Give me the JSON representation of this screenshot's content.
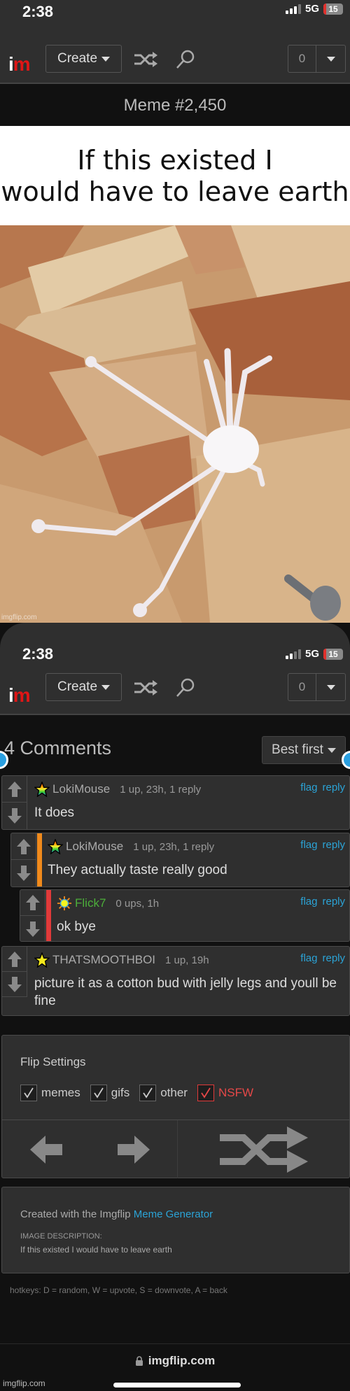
{
  "status_bar": {
    "time": "2:38",
    "network": "5G",
    "battery": "15"
  },
  "nav": {
    "logo_i": "i",
    "logo_m": "m",
    "create_label": "Create",
    "notification_count": "0",
    "icons": [
      "shuffle-icon",
      "search-icon",
      "chevron-down-icon"
    ]
  },
  "meme": {
    "title": "Meme #2,450",
    "caption_line1": "If this existed I",
    "caption_line2": "would have to leave earth",
    "watermark": "imgflip.com"
  },
  "comments": {
    "title": "4 Comments",
    "sort_label": "Best first",
    "flag_label": "flag",
    "reply_label": "reply",
    "items": [
      {
        "user": "LokiMouse",
        "meta": "1 up, 23h, 1 reply",
        "text": "It does",
        "badge": "rainbow-star-icon",
        "user_color": "#aaaaaa",
        "bar_color": ""
      },
      {
        "user": "LokiMouse",
        "meta": "1 up, 23h, 1 reply",
        "text": "They actually taste really good",
        "badge": "rainbow-star-icon",
        "user_color": "#aaaaaa",
        "bar_color": "#f08a1c"
      },
      {
        "user": "Flick7",
        "meta": "0 ups, 1h",
        "text": "ok bye",
        "badge": "sun-icon",
        "user_color": "#4caf3a",
        "bar_color": "#e03a3a"
      },
      {
        "user": "THATSMOOTHBOI",
        "meta": "1 up, 19h",
        "text": "picture it as a cotton bud with jelly legs and youll be fine",
        "badge": "yellow-star-icon",
        "user_color": "#aaaaaa",
        "bar_color": ""
      }
    ]
  },
  "flip_settings": {
    "title": "Flip Settings",
    "options": [
      {
        "label": "memes",
        "checked": true
      },
      {
        "label": "gifs",
        "checked": true
      },
      {
        "label": "other",
        "checked": true
      },
      {
        "label": "NSFW",
        "checked": true
      }
    ]
  },
  "credits": {
    "prefix": "Created with the Imgflip ",
    "link": "Meme Generator",
    "desc_label": "IMAGE DESCRIPTION:",
    "desc": "If this existed I would have to leave earth"
  },
  "hotkeys": "hotkeys: D = random, W = upvote, S = downvote, A = back",
  "browser": {
    "url": "imgflip.com"
  },
  "footer_watermark": "imgflip.com",
  "colors": {
    "accent": "#2ba3d6",
    "logo_red": "#e01616",
    "nsfw": "#e54848"
  }
}
